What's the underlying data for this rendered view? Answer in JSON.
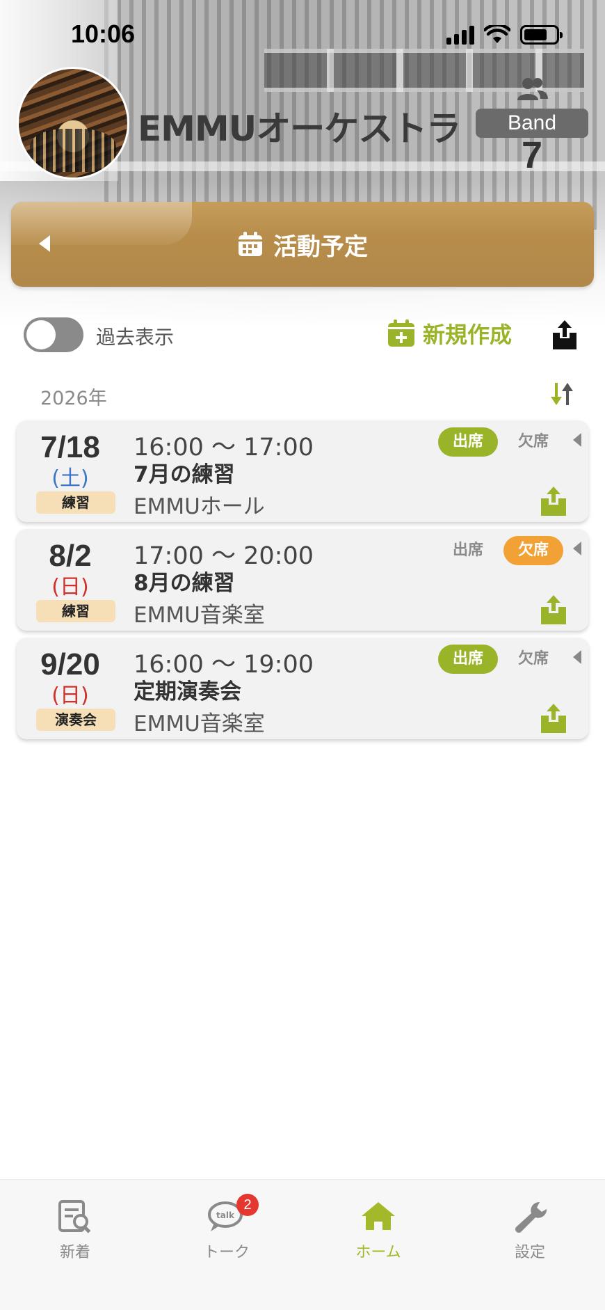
{
  "status_bar": {
    "time": "10:06"
  },
  "band": {
    "name": "EMMUオーケストラ",
    "badge": "Band",
    "member_count": "7"
  },
  "banner": {
    "title": "活動予定"
  },
  "controls": {
    "past_toggle_label": "過去表示",
    "new_label": "新規作成",
    "year": "2026年"
  },
  "events": [
    {
      "date": "7/18",
      "dow": "(土)",
      "tag": "練習",
      "time": "16:00 〜 17:00",
      "title": "7月の練習",
      "place": "EMMUホール",
      "attend_label": "出席",
      "absent_label": "欠席",
      "status": "attend"
    },
    {
      "date": "8/2",
      "dow": "(日)",
      "tag": "練習",
      "time": "17:00 〜 20:00",
      "title": "8月の練習",
      "place": "EMMU音楽室",
      "attend_label": "出席",
      "absent_label": "欠席",
      "status": "absent"
    },
    {
      "date": "9/20",
      "dow": "(日)",
      "tag": "演奏会",
      "time": "16:00 〜 19:00",
      "title": "定期演奏会",
      "place": "EMMU音楽室",
      "attend_label": "出席",
      "absent_label": "欠席",
      "status": "attend"
    }
  ],
  "tabbar": {
    "items": [
      {
        "label": "新着",
        "icon": "news-search-icon"
      },
      {
        "label": "トーク",
        "icon": "talk-bubble-icon",
        "badge": "2"
      },
      {
        "label": "ホーム",
        "icon": "home-icon",
        "active": true
      },
      {
        "label": "設定",
        "icon": "wrench-icon"
      }
    ]
  },
  "colors": {
    "accent_green": "#9ab42a",
    "absent_orange": "#f2a135",
    "banner_gold": "#b88d4b",
    "saturday_blue": "#3b76c4",
    "sunday_red": "#d0302a",
    "badge_red": "#e5362f"
  }
}
